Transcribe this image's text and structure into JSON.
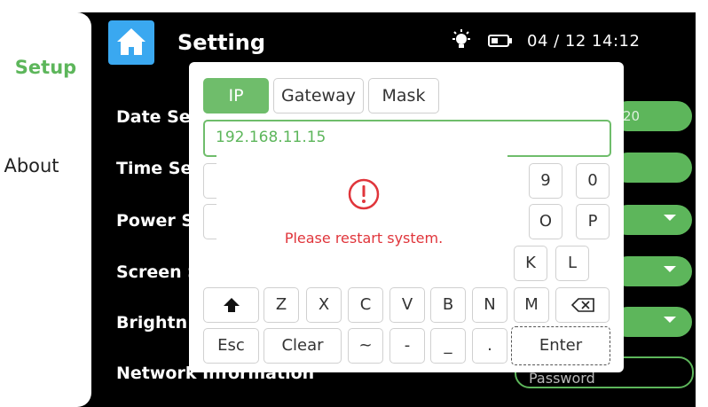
{
  "sidebar": {
    "items": [
      {
        "label": "Setup"
      },
      {
        "label": "About"
      }
    ]
  },
  "header": {
    "title": "Setting",
    "datetime": "04 / 12  14:12"
  },
  "settings": {
    "rows": [
      {
        "label": "Date Se"
      },
      {
        "label": "Time Se"
      },
      {
        "label": "Power S"
      },
      {
        "label": "Screen S"
      },
      {
        "label": "Brightn"
      },
      {
        "label": "Network Information"
      }
    ],
    "date_value_fragment": "20",
    "password_placeholder": "Password"
  },
  "keyboard": {
    "tabs": [
      {
        "label": "IP",
        "active": true
      },
      {
        "label": "Gateway"
      },
      {
        "label": "Mask"
      }
    ],
    "input_value": "192.168.11.15",
    "row1_visible": [
      "9",
      "0"
    ],
    "row2_visible": [
      "O",
      "P"
    ],
    "row3_visible": [
      "K",
      "L"
    ],
    "row4": [
      "Z",
      "X",
      "C",
      "V",
      "B",
      "N",
      "M"
    ],
    "row5": [
      "Esc",
      "Clear",
      "~",
      "-",
      "_",
      ".",
      "Enter"
    ]
  },
  "dialog": {
    "message": "Please restart system."
  },
  "colors": {
    "accent": "#5db65b",
    "error": "#e0353b",
    "home": "#3aa8f0"
  }
}
